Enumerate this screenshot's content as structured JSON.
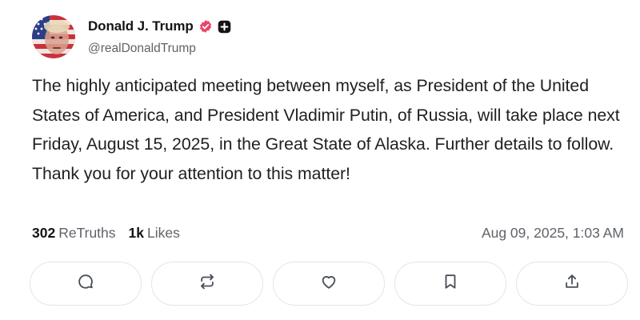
{
  "author": {
    "display_name": "Donald J. Trump",
    "handle": "@realDonaldTrump",
    "verified_badge_icon": "verified-badge-icon",
    "badge_color": "#e9446a",
    "plus_badge_icon": "plus-badge-icon"
  },
  "post": {
    "text": "The highly anticipated meeting between myself, as President of the United States of America, and President Vladimir Putin, of Russia, will take place next Friday, August 15, 2025, in the Great State of Alaska. Further details to follow. Thank you for your attention to this matter!",
    "retruths_count": "302",
    "retruths_label": "ReTruths",
    "likes_count": "1k",
    "likes_label": "Likes",
    "timestamp": "Aug 09, 2025, 1:03 AM"
  },
  "actions": [
    {
      "icon": "reply-icon"
    },
    {
      "icon": "retruth-icon"
    },
    {
      "icon": "like-heart-icon"
    },
    {
      "icon": "bookmark-icon"
    },
    {
      "icon": "share-icon"
    }
  ]
}
